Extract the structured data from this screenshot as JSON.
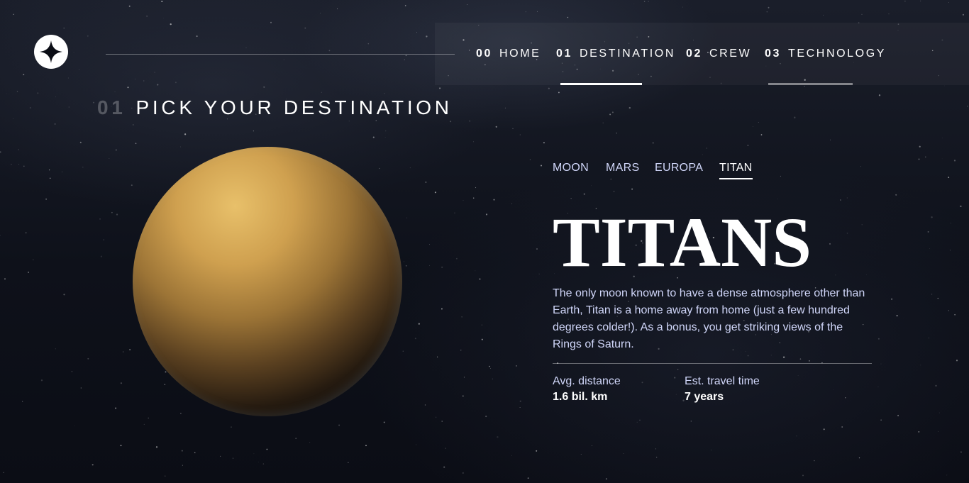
{
  "nav": {
    "items": [
      {
        "num": "00",
        "label": "HOME"
      },
      {
        "num": "01",
        "label": "DESTINATION"
      },
      {
        "num": "02",
        "label": "CREW"
      },
      {
        "num": "03",
        "label": "TECHNOLOGY"
      }
    ],
    "active_index": 1,
    "hover_index": 3
  },
  "page": {
    "heading_num": "01",
    "heading_text": "PICK YOUR DESTINATION"
  },
  "destination": {
    "tabs": [
      "MOON",
      "MARS",
      "EUROPA",
      "TITAN"
    ],
    "active_tab": "TITAN",
    "name": "TITANS",
    "description": "The only moon known to have a dense atmosphere other than Earth, Titan is a home away from home (just a few hundred degrees colder!). As a bonus, you get striking views of the Rings of Saturn.",
    "distance_label": "Avg. distance",
    "distance_value": "1.6 bil. km",
    "travel_label": "Est. travel time",
    "travel_value": "7 years"
  },
  "colors": {
    "background": "#0b0d15",
    "text_primary": "#ffffff",
    "text_secondary": "#d0d6f9",
    "planet": "#d8ad5c"
  },
  "icons": {
    "logo": "four-point-star-icon",
    "planet": "titan-planet-image"
  }
}
